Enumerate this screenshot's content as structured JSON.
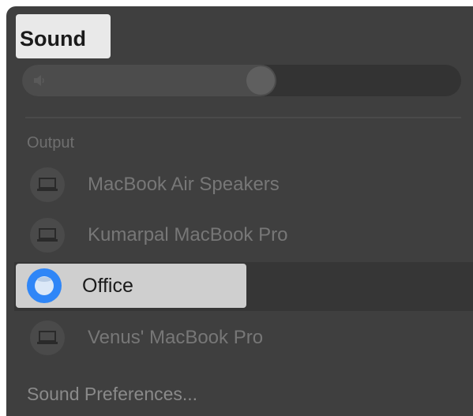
{
  "panel": {
    "title": "Sound"
  },
  "volume": {
    "level_fraction": 0.55
  },
  "output": {
    "section_label": "Output",
    "devices": [
      {
        "label": "MacBook Air Speakers",
        "icon": "laptop-icon",
        "selected": false
      },
      {
        "label": "Kumarpal MacBook Pro",
        "icon": "laptop-icon",
        "selected": false
      },
      {
        "label": "Office",
        "icon": "homepod-icon",
        "selected": true
      },
      {
        "label": "Venus' MacBook Pro",
        "icon": "laptop-icon",
        "selected": false
      }
    ]
  },
  "footer": {
    "preferences_label": "Sound Preferences..."
  },
  "colors": {
    "panel_bg": "#3f3f3f",
    "accent_blue": "#2f86f7",
    "highlight": "#e9e9e9"
  }
}
